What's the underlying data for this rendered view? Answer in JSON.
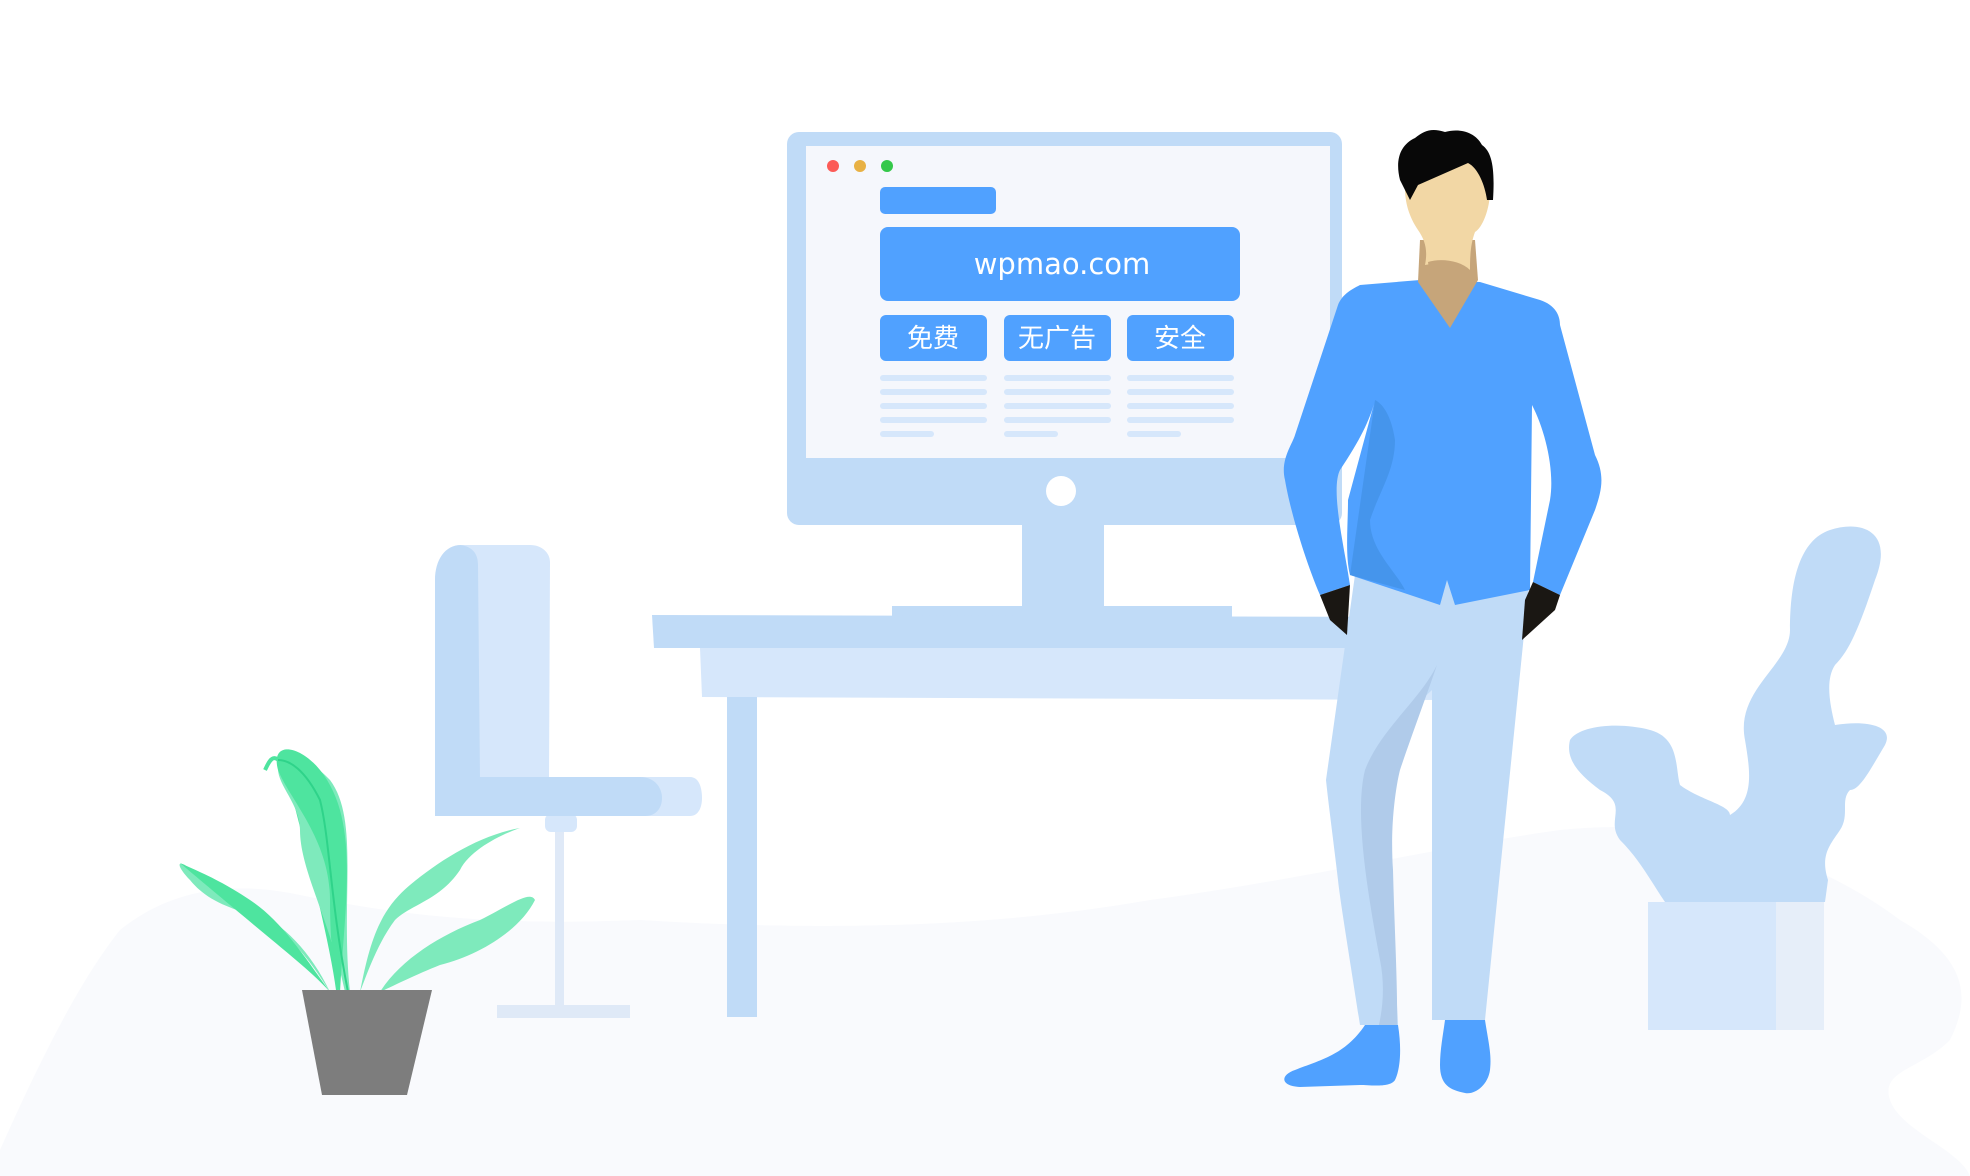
{
  "illustration": {
    "screen": {
      "window_controls": [
        "close",
        "minimize",
        "maximize"
      ],
      "site_domain": "wpmao.com",
      "features": [
        {
          "label": "免费"
        },
        {
          "label": "无广告"
        },
        {
          "label": "安全"
        }
      ]
    },
    "colors": {
      "primary_blue": "#50a1ff",
      "light_blue": "#c0dbf7",
      "pale_blue": "#d6e7fb",
      "screen_bg": "#f5f7fc",
      "plant_green": "#7eeabc",
      "plant_dark_green": "#4ee49f",
      "pot_gray": "#7d7d7d",
      "dot_red": "#fc5b57",
      "dot_yellow": "#e8b144",
      "dot_green": "#34c84a"
    }
  }
}
